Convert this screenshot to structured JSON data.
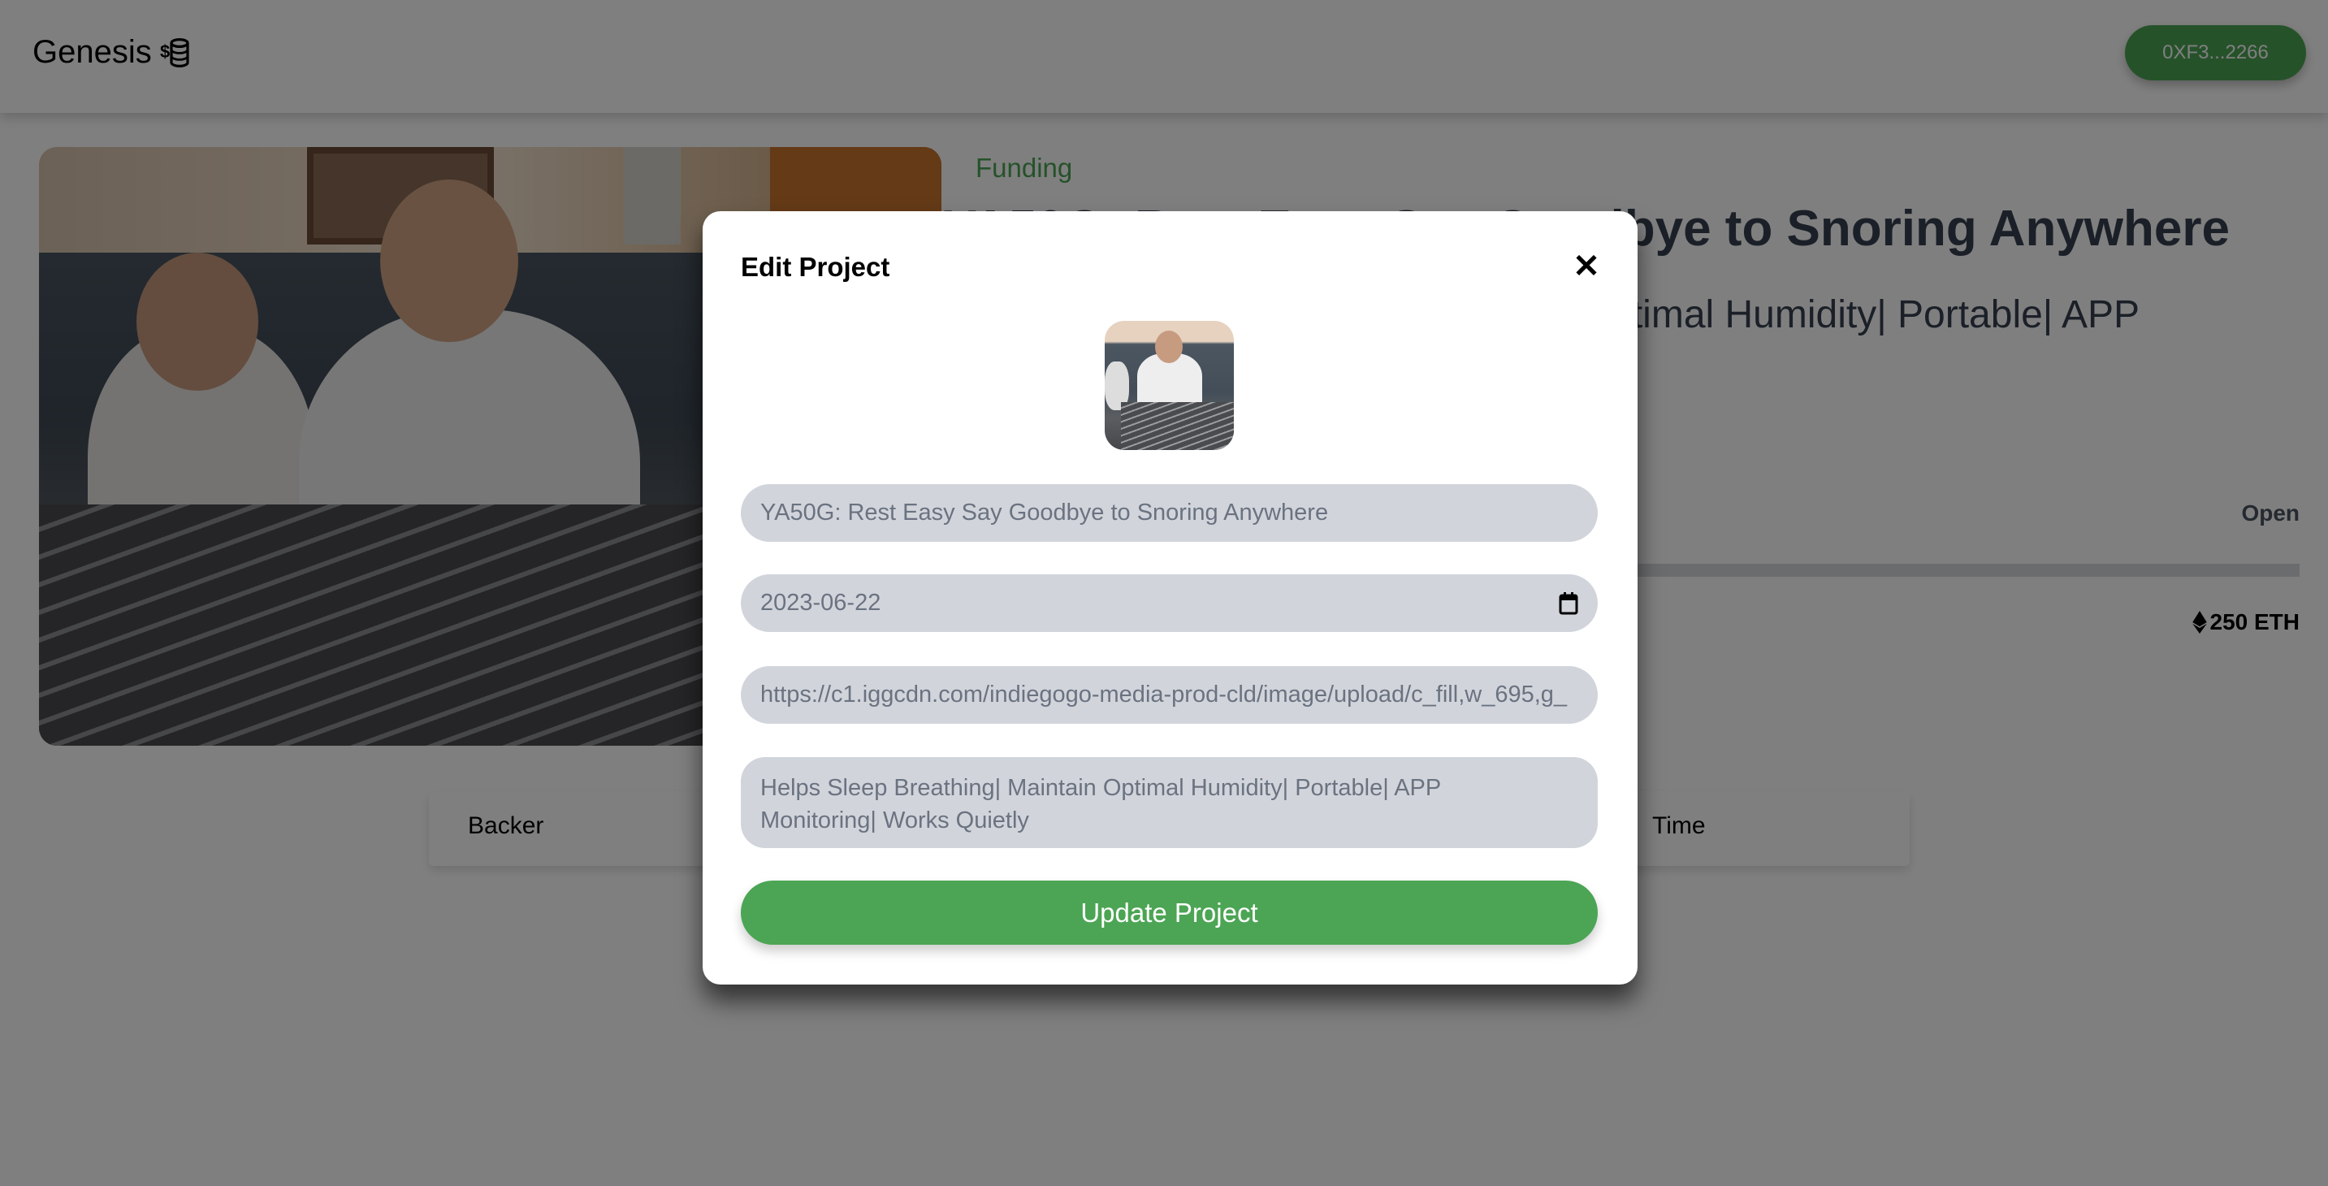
{
  "header": {
    "brand": "Genesis",
    "brand_icon": "coins-dollar-icon",
    "wallet_label": "0XF3...2266"
  },
  "project": {
    "category": "Funding",
    "title": "YA50G: Rest Easy Say Goodbye to Snoring Anywhere",
    "subtitle": "Helps Sleep Breathing| Maintain Optimal Humidity| Portable| APP",
    "status": "Open",
    "progress_percent": 0,
    "target": "250 ETH",
    "target_icon": "ethereum-icon"
  },
  "backers_table": {
    "columns": [
      "Backer",
      "Time"
    ]
  },
  "modal": {
    "title": "Edit Project",
    "close_icon": "close-icon",
    "title_value": "YA50G: Rest Easy Say Goodbye to Snoring Anywhere",
    "date_value": "2023-06-22",
    "image_url_value": "https://c1.iggcdn.com/indiegogo-media-prod-cld/image/upload/c_fill,w_695,g_",
    "description_value": "Helps Sleep Breathing| Maintain Optimal Humidity| Portable| APP Monitoring| Works Quietly",
    "submit_label": "Update Project"
  },
  "colors": {
    "accent": "#4ca554",
    "input_bg": "#d1d5db",
    "title_text": "#374151"
  }
}
